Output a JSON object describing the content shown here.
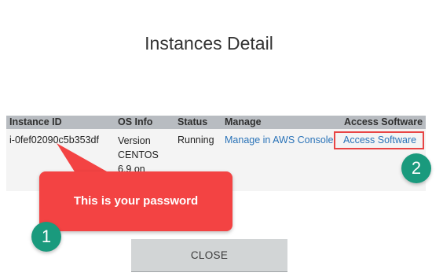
{
  "dialog": {
    "title": "Instances Detail",
    "close_label": "CLOSE"
  },
  "table": {
    "headers": [
      "Instance ID",
      "OS Info",
      "Status",
      "Manage",
      "Access Software"
    ],
    "row": {
      "instance_id": "i-0fef02090c5b353df",
      "os_info_lines": [
        "Version",
        "CENTOS",
        "6.9 on"
      ],
      "status": "Running",
      "manage_link": "Manage in AWS Console",
      "access_link": "Access Software"
    }
  },
  "annotations": {
    "callout_text": "This is your password",
    "step_1": "1",
    "step_2": "2",
    "callout_color": "#f34343",
    "badge_color": "#1a9a7d",
    "highlight_color": "#e84545"
  }
}
